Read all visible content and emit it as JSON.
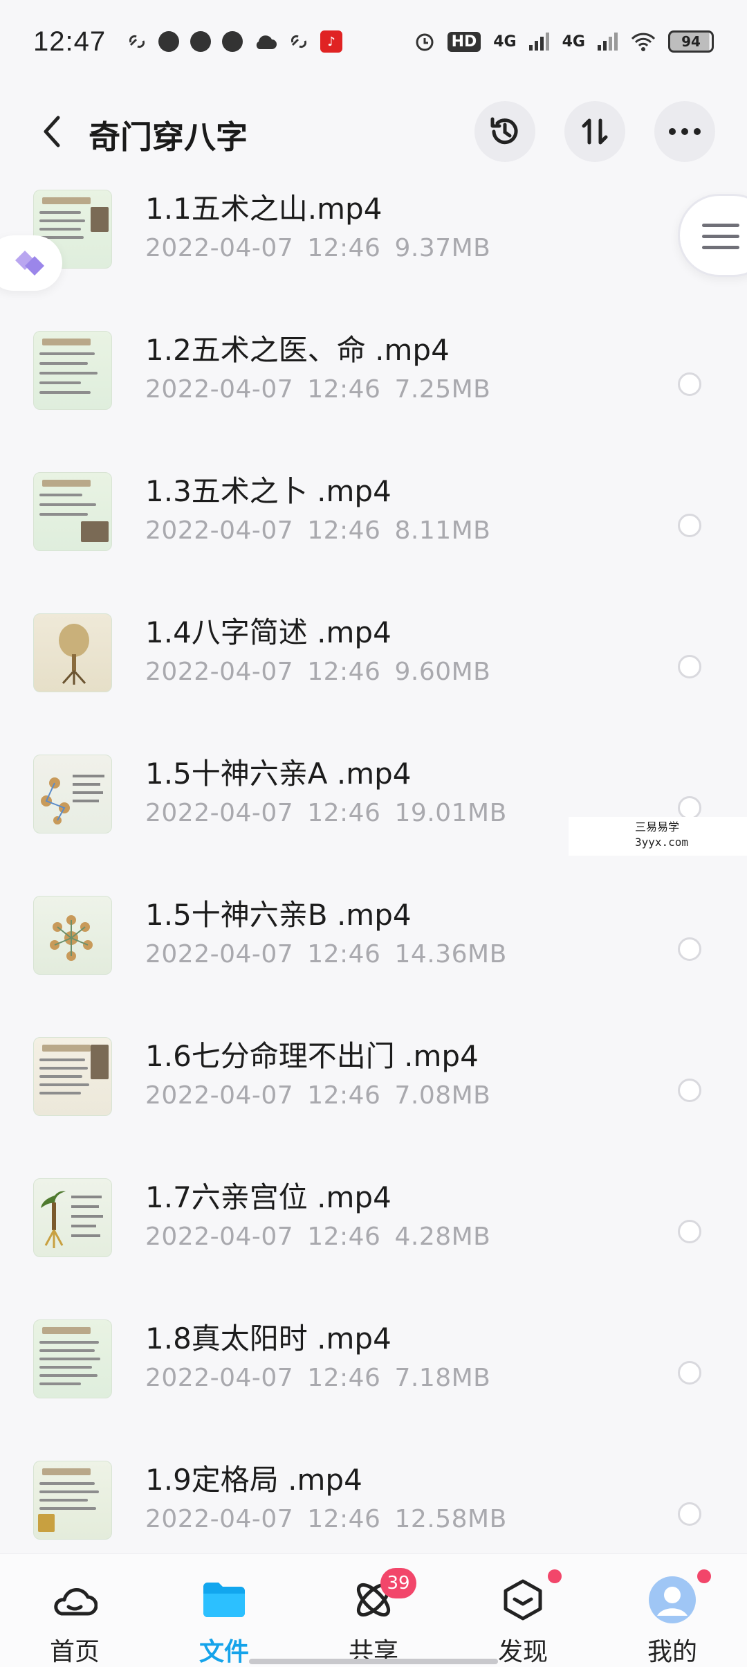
{
  "status_bar": {
    "time": "12:47",
    "hd": "HD",
    "sim1": "4G",
    "sim2": "4G",
    "battery": "94"
  },
  "header": {
    "title": "奇门穿八字"
  },
  "files": [
    {
      "name": "1.1五术之山.mp4",
      "date": "2022-04-07",
      "time": "12:46",
      "size": "9.37MB"
    },
    {
      "name": "1.2五术之医、命 .mp4",
      "date": "2022-04-07",
      "time": "12:46",
      "size": "7.25MB"
    },
    {
      "name": "1.3五术之卜 .mp4",
      "date": "2022-04-07",
      "time": "12:46",
      "size": "8.11MB"
    },
    {
      "name": "1.4八字简述 .mp4",
      "date": "2022-04-07",
      "time": "12:46",
      "size": "9.60MB"
    },
    {
      "name": "1.5十神六亲A .mp4",
      "date": "2022-04-07",
      "time": "12:46",
      "size": "19.01MB"
    },
    {
      "name": "1.5十神六亲B .mp4",
      "date": "2022-04-07",
      "time": "12:46",
      "size": "14.36MB"
    },
    {
      "name": "1.6七分命理不出门 .mp4",
      "date": "2022-04-07",
      "time": "12:46",
      "size": "7.08MB"
    },
    {
      "name": "1.7六亲宫位 .mp4",
      "date": "2022-04-07",
      "time": "12:46",
      "size": "4.28MB"
    },
    {
      "name": "1.8真太阳时 .mp4",
      "date": "2022-04-07",
      "time": "12:46",
      "size": "7.18MB"
    },
    {
      "name": "1.9定格局 .mp4",
      "date": "2022-04-07",
      "time": "12:46",
      "size": "12.58MB"
    }
  ],
  "watermark": {
    "line1": "三易易学",
    "line2": "3yyx.com"
  },
  "bottom_nav": {
    "items": [
      {
        "label": "首页",
        "icon": "cloud-home-icon"
      },
      {
        "label": "文件",
        "icon": "folder-icon"
      },
      {
        "label": "共享",
        "icon": "share-atom-icon",
        "badge": "39"
      },
      {
        "label": "发现",
        "icon": "discover-box-icon"
      },
      {
        "label": "我的",
        "icon": "avatar-icon"
      }
    ]
  },
  "colors": {
    "accent": "#15a3ea",
    "badge": "#f2466a"
  }
}
